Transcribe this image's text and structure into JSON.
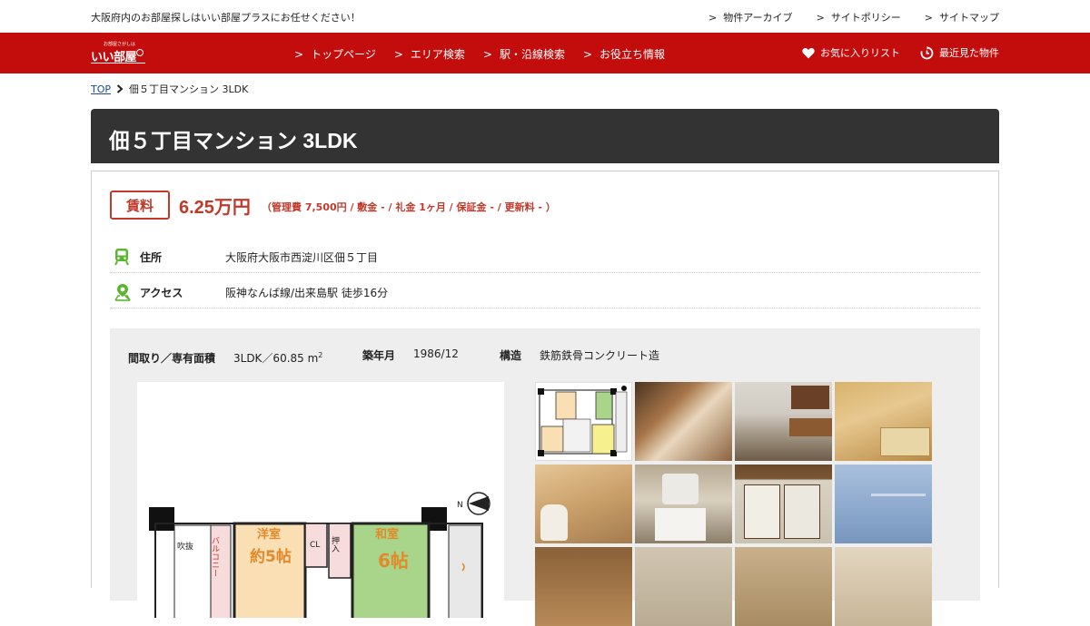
{
  "topbar": {
    "tagline": "大阪府内のお部屋探しはいい部屋プラスにお任せください！",
    "links": [
      "物件アーカイブ",
      "サイトポリシー",
      "サイトマップ"
    ],
    "chevron": ">"
  },
  "logo": {
    "small_text": "お部屋さがしは",
    "main_text": "いい部屋",
    "sub_text": "プラス"
  },
  "nav": {
    "chevron": ">",
    "items": [
      "トップページ",
      "エリア検索",
      "駅・沿線検索",
      "お役立ち情報"
    ],
    "favorites": "お気に入りリスト",
    "recent": "最近見た物件"
  },
  "breadcrumb": {
    "home": "TOP",
    "current": "佃５丁目マンション 3LDK"
  },
  "property": {
    "title": "佃５丁目マンション  3LDK",
    "rent_label": "賃料",
    "rent_price": "6.25万円",
    "rent_detail": "（管理費 7,500円 / 敷金 - / 礼金 1ヶ月 / 保証金 - / 更新料 - ）",
    "address_label": "住所",
    "address_value": "大阪府大阪市西淀川区佃５丁目",
    "access_label": "アクセス",
    "access_value": "阪神なんば線/出来島駅 徒歩16分",
    "layout_label": "間取り／専有面積",
    "layout_value": "3LDK／60.85 m",
    "layout_sup": "2",
    "built_label": "築年月",
    "built_value": "1986/12",
    "structure_label": "構造",
    "structure_value": "鉄筋鉄骨コンクリート造"
  },
  "floorplan": {
    "rooms": {
      "western": "洋室",
      "western_size": "約5帖",
      "japanese": "和室",
      "japanese_size": "6帖",
      "balcony": "バルコニー",
      "fukinuke": "吹抜",
      "cl": "CL",
      "oshiire": "押入"
    }
  },
  "colors": {
    "brand_red": "#c30d0d",
    "price_red": "#c0392b",
    "title_bg": "#333333",
    "icon_green": "#5cb531"
  }
}
